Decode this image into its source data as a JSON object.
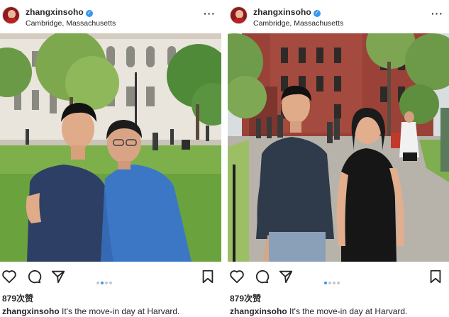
{
  "posts": [
    {
      "username": "zhangxinsoho",
      "location": "Cambridge, Massachusetts",
      "likes": "879次赞",
      "caption": "It's the move-in day at Harvard.",
      "carousel_active_index": 1,
      "carousel_count": 4
    },
    {
      "username": "zhangxinsoho",
      "location": "Cambridge, Massachusetts",
      "likes": "879次赞",
      "caption": "It's the move-in day at Harvard.",
      "carousel_active_index": 0,
      "carousel_count": 4
    }
  ],
  "icons": {
    "verified": "verified-badge-icon",
    "more": "more-options-icon",
    "like": "heart-icon",
    "comment": "comment-icon",
    "share": "share-icon",
    "save": "bookmark-icon"
  },
  "colors": {
    "verified": "#3897f0",
    "carousel_active": "#3897f0",
    "carousel_inactive": "#c7c7c7",
    "text": "#262626"
  }
}
